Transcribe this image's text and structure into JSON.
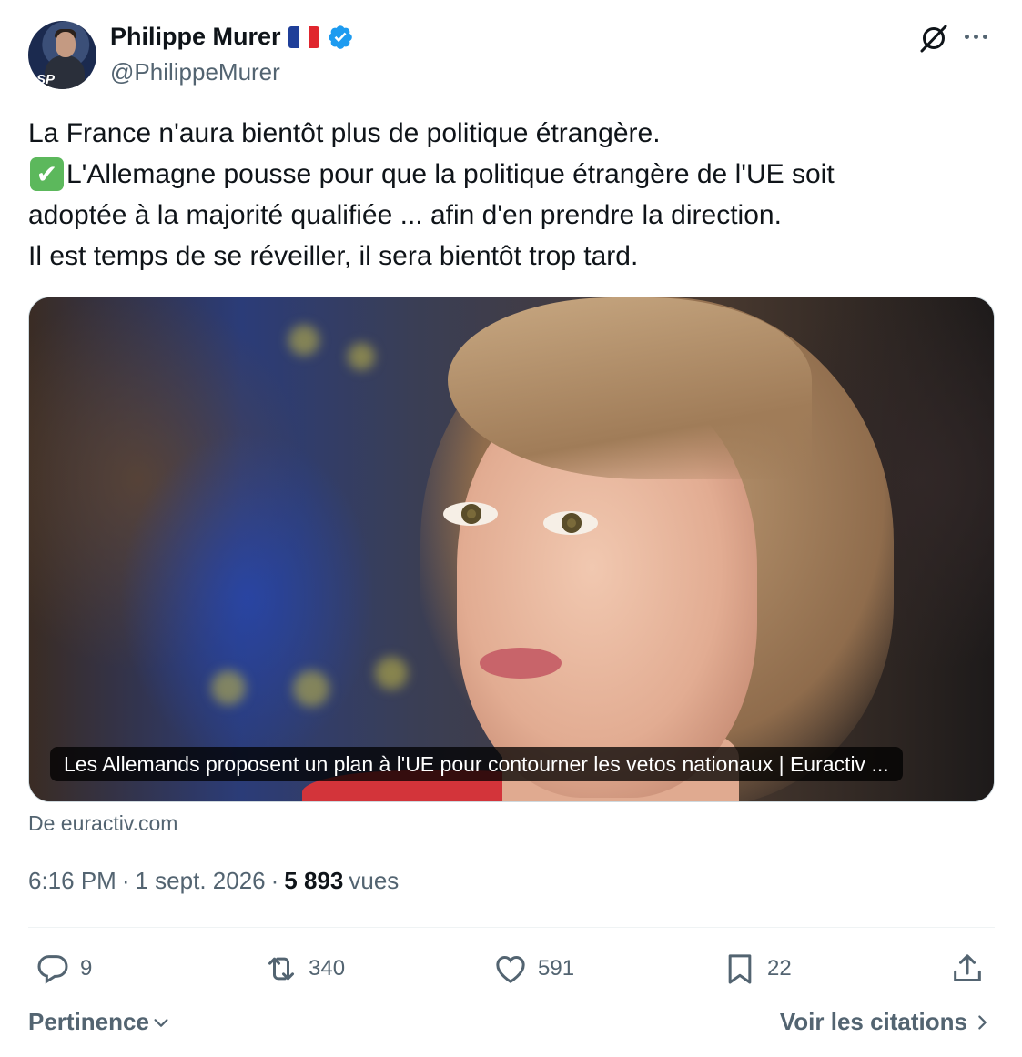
{
  "author": {
    "display_name": "Philippe Murer",
    "handle": "@PhilippeMurer",
    "avatar_icon": "profile-photo",
    "avatar_badge_text": "SP",
    "flag": "france-flag",
    "verified": true,
    "verified_color": "#1d9bf0"
  },
  "header": {
    "grok_icon": "grok-icon",
    "more_icon": "more-options-icon"
  },
  "tweet": {
    "lines": [
      "La France n'aura bientôt plus de politique étrangère.",
      "L'Allemagne pousse pour que la politique étrangère de l'UE soit",
      "adoptée à la majorité qualifiée ... afin d'en prendre la direction.",
      "Il est temps de se réveiller, il sera bientôt trop tard."
    ],
    "check_emoji": "✔"
  },
  "card": {
    "caption": "Les Allemands proposent un plan à l'UE pour contourner les vetos nationaux | Euractiv ...",
    "source": "De euractiv.com"
  },
  "meta": {
    "time": "6:16 PM",
    "separator": "·",
    "date": "1 sept. 2026",
    "views_count": "5 893",
    "views_label": "vues"
  },
  "actions": {
    "replies": "9",
    "reposts": "340",
    "likes": "591",
    "bookmarks": "22"
  },
  "footer": {
    "sort_label": "Pertinence",
    "quotes_label": "Voir les citations"
  }
}
